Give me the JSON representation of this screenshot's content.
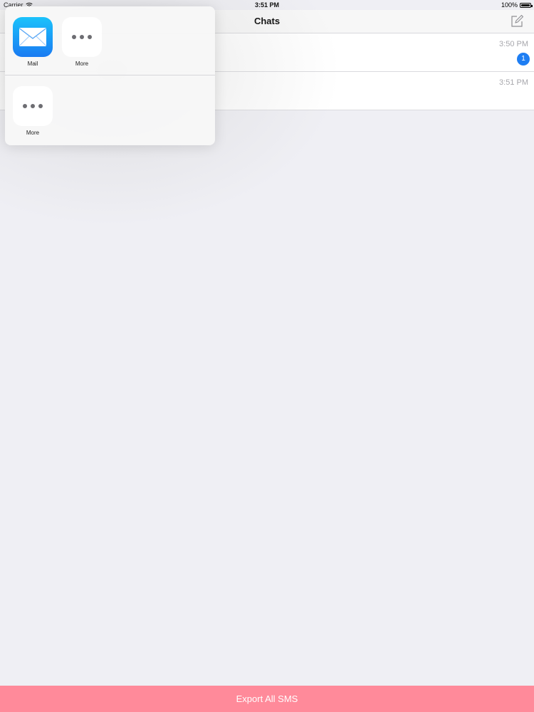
{
  "status_bar": {
    "carrier": "Carrier",
    "time": "3:51 PM",
    "battery": "100%"
  },
  "nav": {
    "title": "Chats",
    "compose_icon": "compose-icon"
  },
  "chats": [
    {
      "time": "3:50 PM",
      "badge": "1"
    },
    {
      "time": "3:51 PM"
    }
  ],
  "share_sheet": {
    "row1": [
      {
        "label": "Mail",
        "icon": "mail-icon"
      },
      {
        "label": "More",
        "icon": "more-icon"
      }
    ],
    "row2": [
      {
        "label": "More",
        "icon": "more-icon"
      }
    ]
  },
  "export": {
    "label": "Export All SMS"
  },
  "colors": {
    "accent_blue": "#1e7ef3",
    "export_bar": "#ff8a9a",
    "background": "#efeff4"
  }
}
